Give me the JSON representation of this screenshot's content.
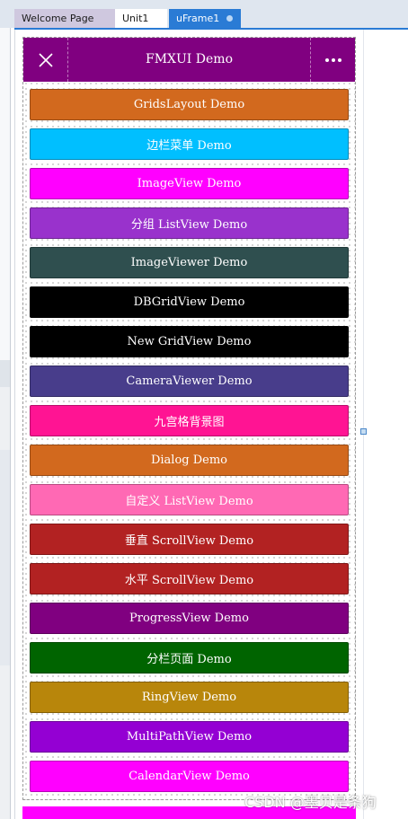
{
  "ide": {
    "tabs": [
      {
        "label": "Welcome Page"
      },
      {
        "label": "Unit1"
      },
      {
        "label": "uFrame1"
      }
    ]
  },
  "app": {
    "title": "FMXUI Demo",
    "header_color": "#800080",
    "close_icon": "close-icon",
    "more_icon": "more-icon"
  },
  "items": [
    {
      "label": "GridsLayout Demo",
      "color": "#D2691E"
    },
    {
      "label": "边栏菜单 Demo",
      "color": "#00BFFF"
    },
    {
      "label": "ImageView Demo",
      "color": "#FF00FF"
    },
    {
      "label": "分组 ListView Demo",
      "color": "#9932CC"
    },
    {
      "label": "ImageViewer Demo",
      "color": "#2F4F4F"
    },
    {
      "label": "DBGridView Demo",
      "color": "#000000"
    },
    {
      "label": "New GridView Demo",
      "color": "#000000"
    },
    {
      "label": "CameraViewer Demo",
      "color": "#483D8B"
    },
    {
      "label": "九宫格背景图",
      "color": "#FF1493"
    },
    {
      "label": "Dialog Demo",
      "color": "#D2691E"
    },
    {
      "label": "自定义 ListView Demo",
      "color": "#FF69B4"
    },
    {
      "label": "垂直 ScrollView Demo",
      "color": "#B22222"
    },
    {
      "label": "水平 ScrollView Demo",
      "color": "#B22222"
    },
    {
      "label": "ProgressView Demo",
      "color": "#800080"
    },
    {
      "label": "分栏页面 Demo",
      "color": "#006400"
    },
    {
      "label": "RingView Demo",
      "color": "#B8860B"
    },
    {
      "label": "MultiPathView Demo",
      "color": "#9400D3"
    },
    {
      "label": "CalendarView Demo",
      "color": "#FF00FF"
    }
  ],
  "watermark": "CSDN @墨贝是条狗"
}
